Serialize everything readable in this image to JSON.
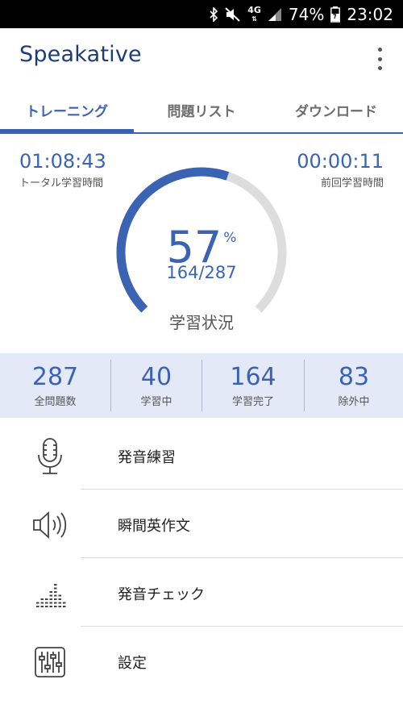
{
  "status_bar": {
    "battery": "74%",
    "time": "23:02",
    "network": "4G",
    "icons": [
      "bluetooth-icon",
      "mute-icon",
      "signal-icon",
      "battery-charging-icon"
    ]
  },
  "app": {
    "title": "Speakative"
  },
  "tabs": [
    {
      "label": "トレーニング",
      "active": true
    },
    {
      "label": "問題リスト",
      "active": false
    },
    {
      "label": "ダウンロード",
      "active": false
    }
  ],
  "times": {
    "total": {
      "value": "01:08:43",
      "label": "トータル学習時間"
    },
    "last": {
      "value": "00:00:11",
      "label": "前回学習時間"
    }
  },
  "progress": {
    "percent": "57",
    "percent_sign": "%",
    "fraction": 0.57,
    "count": "164/287",
    "label": "学習状況"
  },
  "stats": [
    {
      "value": "287",
      "label": "全問題数"
    },
    {
      "value": "40",
      "label": "学習中"
    },
    {
      "value": "164",
      "label": "学習完了"
    },
    {
      "value": "83",
      "label": "除外中"
    }
  ],
  "menu": [
    {
      "label": "発音練習",
      "icon": "microphone-icon"
    },
    {
      "label": "瞬間英作文",
      "icon": "speaker-icon"
    },
    {
      "label": "発音チェック",
      "icon": "level-meter-icon"
    },
    {
      "label": "設定",
      "icon": "equalizer-settings-icon"
    }
  ],
  "colors": {
    "accent": "#3b63b4",
    "title": "#1f3b78",
    "stats_bg": "#e3e9f7",
    "track": "#dddddd"
  }
}
